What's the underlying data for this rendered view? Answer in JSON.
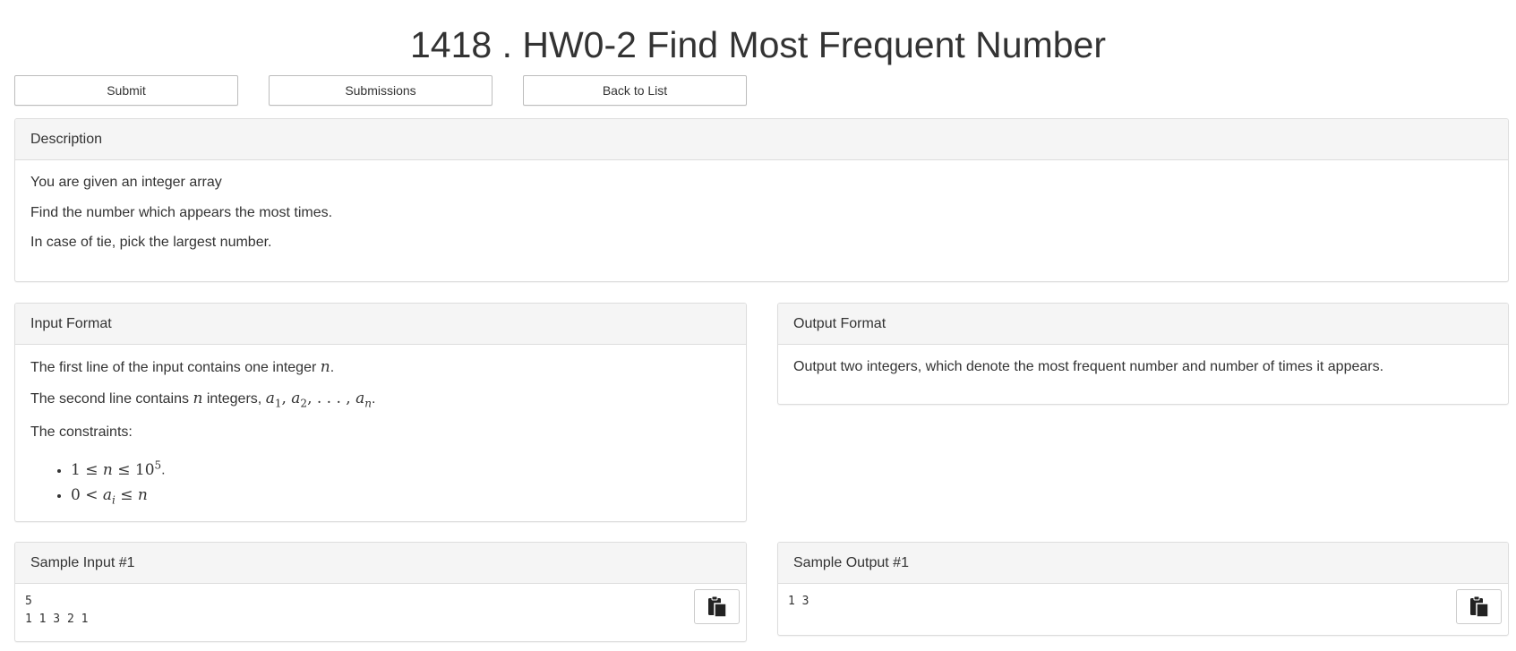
{
  "problem": {
    "title": "1418 . HW0-2 Find Most Frequent Number"
  },
  "actions": {
    "submit": "Submit",
    "submissions": "Submissions",
    "back": "Back to List"
  },
  "description": {
    "heading": "Description",
    "lines": [
      "You are given an integer array",
      "Find the number which appears the most times.",
      "In case of tie, pick the largest number."
    ]
  },
  "input_format": {
    "heading": "Input Format",
    "line1_text": "The first line of the input contains one integer",
    "line2_text": "The second line contains",
    "line2_mid": "integers,",
    "constraints_label": "The constraints:"
  },
  "output_format": {
    "heading": "Output Format",
    "text": "Output two integers, which denote the most frequent number and number of times it appears."
  },
  "sample_input": {
    "heading": "Sample Input #1",
    "content": "5\n1 1 3 2 1"
  },
  "sample_output": {
    "heading": "Sample Output #1",
    "content": "1 3"
  },
  "icons": {
    "copy": "clipboard-copy-icon"
  }
}
